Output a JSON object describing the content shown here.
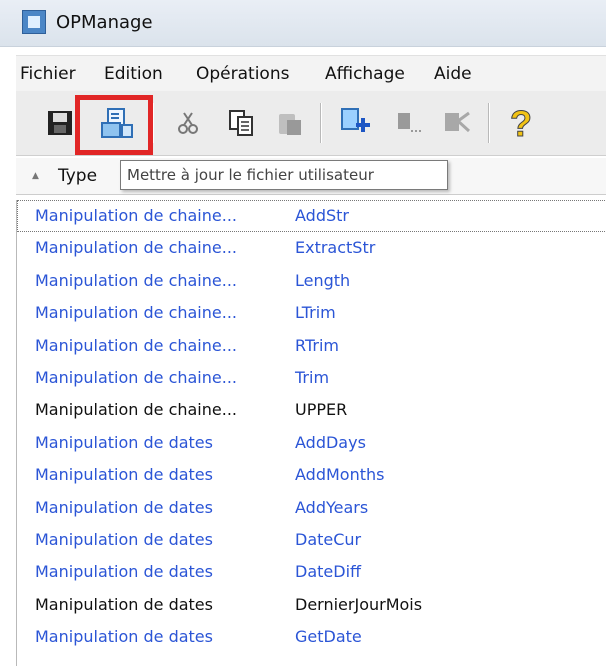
{
  "window": {
    "title": "OPManage"
  },
  "menu": [
    "Fichier",
    "Edition",
    "Opérations",
    "Affichage",
    "Aide"
  ],
  "toolbar": {
    "tooltip": "Mettre à jour le fichier utilisateur",
    "icons": [
      "save-icon",
      "update-user-file-icon",
      "cut-icon",
      "copy-icon",
      "paste-icon",
      "add-icon",
      "insert-icon",
      "delete-icon",
      "help-icon"
    ]
  },
  "list": {
    "columns": [
      "Type"
    ],
    "rows": [
      {
        "type": "Manipulation de chaine...",
        "name": "AddStr"
      },
      {
        "type": "Manipulation de chaine...",
        "name": "ExtractStr"
      },
      {
        "type": "Manipulation de chaine...",
        "name": "Length"
      },
      {
        "type": "Manipulation de chaine...",
        "name": "LTrim"
      },
      {
        "type": "Manipulation de chaine...",
        "name": "RTrim"
      },
      {
        "type": "Manipulation de chaine...",
        "name": "Trim"
      },
      {
        "type": "Manipulation de chaine...",
        "name": "UPPER"
      },
      {
        "type": "Manipulation de dates",
        "name": "AddDays"
      },
      {
        "type": "Manipulation de dates",
        "name": "AddMonths"
      },
      {
        "type": "Manipulation de dates",
        "name": "AddYears"
      },
      {
        "type": "Manipulation de dates",
        "name": "DateCur"
      },
      {
        "type": "Manipulation de dates",
        "name": "DateDiff"
      },
      {
        "type": "Manipulation de dates",
        "name": "DernierJourMois"
      },
      {
        "type": "Manipulation de dates",
        "name": "GetDate"
      }
    ]
  },
  "colors": {
    "link_blue": "#2b55d6",
    "highlight_red": "#e12626"
  }
}
